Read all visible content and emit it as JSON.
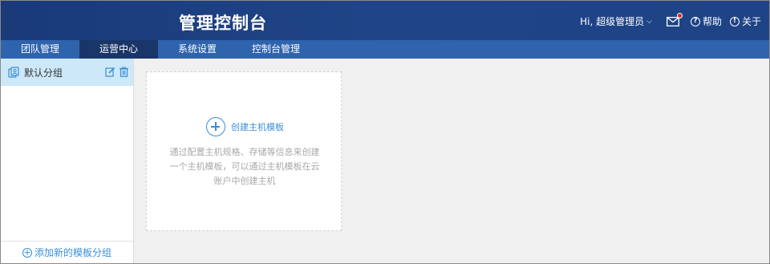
{
  "header": {
    "title": "管理控制台",
    "greeting": "Hi, 超级管理员",
    "help_label": "帮助",
    "about_label": "关于",
    "colors": {
      "bg": "#1f4588",
      "badge": "#e0242c"
    }
  },
  "nav": {
    "tabs": [
      {
        "label": "团队管理"
      },
      {
        "label": "运营中心",
        "active": true
      },
      {
        "label": "系统设置"
      },
      {
        "label": "控制台管理"
      }
    ],
    "colors": {
      "bg": "#2e63ad",
      "active": "#1a3668"
    }
  },
  "sidebar": {
    "group_label": "默认分组",
    "add_label": "添加新的模板分组",
    "icons": [
      "group-icon",
      "edit-icon",
      "delete-icon",
      "plus-circle-icon"
    ]
  },
  "card": {
    "create_label": "创建主机模板",
    "desc_lines": [
      "通过配置主机规格、存储等信息来创建",
      "一个主机模板，可以通过主机模板在云",
      "账户中创建主机"
    ]
  }
}
